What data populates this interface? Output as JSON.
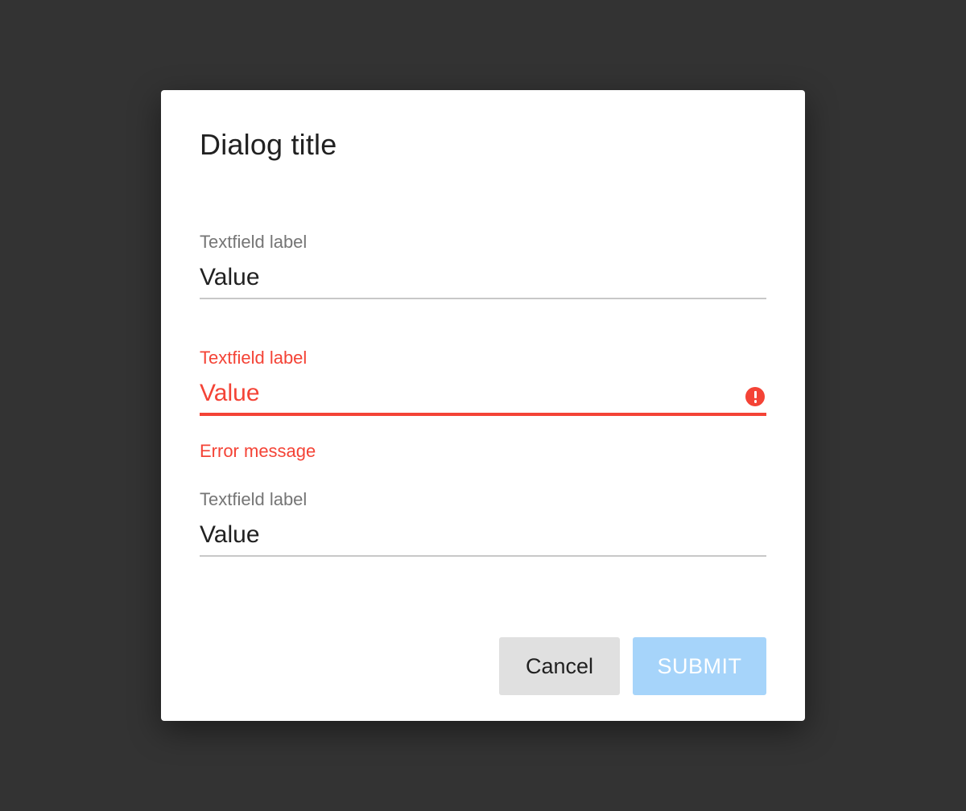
{
  "dialog": {
    "title": "Dialog title",
    "fields": [
      {
        "label": "Textfield label",
        "value": "Value",
        "state": "default"
      },
      {
        "label": "Textfield label",
        "value": "Value",
        "state": "error",
        "error_message": "Error message"
      },
      {
        "label": "Textfield label",
        "value": "Value",
        "state": "default"
      }
    ],
    "actions": {
      "cancel_label": "Cancel",
      "submit_label": "SUBMIT",
      "submit_disabled": true
    }
  },
  "colors": {
    "backdrop": "#333333",
    "surface": "#ffffff",
    "error": "#f44336",
    "primary_disabled": "#a6d4fa",
    "secondary_button": "#e0e0e0",
    "label": "#757575",
    "text": "#212121"
  },
  "icons": {
    "error_field_icon": "error-icon"
  }
}
